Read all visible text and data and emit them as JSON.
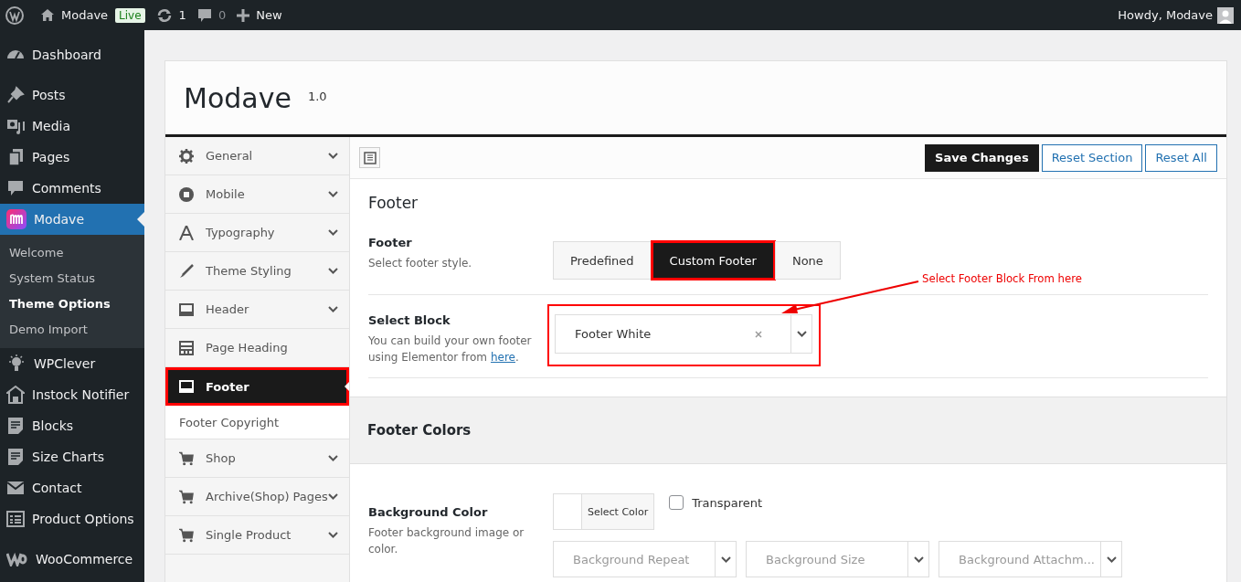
{
  "admin_bar": {
    "site_name": "Modave",
    "live_badge": "Live",
    "updates_count": "1",
    "comments_count": "0",
    "new_label": "New",
    "greeting": "Howdy, Modave"
  },
  "admin_menu": [
    [
      {
        "label": "Dashboard",
        "current": false
      }
    ],
    [
      {
        "label": "Posts",
        "current": false
      },
      {
        "label": "Media",
        "current": false
      },
      {
        "label": "Pages",
        "current": false
      },
      {
        "label": "Comments",
        "current": false
      },
      {
        "label": "Modave",
        "current": true,
        "submenu": [
          {
            "label": "Welcome",
            "current": false
          },
          {
            "label": "System Status",
            "current": false
          },
          {
            "label": "Theme Options",
            "current": true
          },
          {
            "label": "Demo Import",
            "current": false
          }
        ]
      },
      {
        "label": "WPClever",
        "current": false
      },
      {
        "label": "Instock Notifier",
        "current": false
      },
      {
        "label": "Blocks",
        "current": false
      },
      {
        "label": "Size Charts",
        "current": false
      },
      {
        "label": "Contact",
        "current": false
      },
      {
        "label": "Product Options",
        "current": false
      }
    ],
    [
      {
        "label": "WooCommerce",
        "current": false
      }
    ]
  ],
  "panel": {
    "title": "Modave",
    "version": "1.0",
    "nav": [
      {
        "label": "General",
        "expandable": true,
        "selected": false,
        "highlighted": false
      },
      {
        "label": "Mobile",
        "expandable": true,
        "selected": false,
        "highlighted": false
      },
      {
        "label": "Typography",
        "expandable": true,
        "selected": false,
        "highlighted": false
      },
      {
        "label": "Theme Styling",
        "expandable": true,
        "selected": false,
        "highlighted": false
      },
      {
        "label": "Header",
        "expandable": true,
        "selected": false,
        "highlighted": false
      },
      {
        "label": "Page Heading",
        "expandable": false,
        "selected": false,
        "highlighted": false
      },
      {
        "label": "Footer",
        "expandable": false,
        "selected": true,
        "highlighted": true,
        "children": [
          {
            "label": "Footer Copyright",
            "selected": false
          }
        ]
      },
      {
        "label": "Shop",
        "expandable": true,
        "selected": false,
        "highlighted": false
      },
      {
        "label": "Archive(Shop) Pages",
        "expandable": true,
        "selected": false,
        "highlighted": false
      },
      {
        "label": "Single Product",
        "expandable": true,
        "selected": false,
        "highlighted": false
      }
    ],
    "toolbar_buttons": [
      {
        "label": "Save Changes",
        "kind": "primary"
      },
      {
        "label": "Reset Section",
        "kind": "secondary"
      },
      {
        "label": "Reset All",
        "kind": "secondary"
      }
    ],
    "section_title": "Footer",
    "fields": [
      {
        "kind": "buttonset",
        "label": "Footer",
        "description": "Select footer style.",
        "options": [
          {
            "label": "Predefined",
            "selected": false,
            "highlighted": false
          },
          {
            "label": "Custom Footer",
            "selected": true,
            "highlighted": true
          },
          {
            "label": "None",
            "selected": false,
            "highlighted": false
          }
        ]
      },
      {
        "kind": "select",
        "label": "Select Block",
        "description": "You can build your own footer using Elementor from",
        "link": "here",
        "link_suffix": ".",
        "value": "Footer White",
        "highlighted": true
      }
    ],
    "subsection_title": "Footer Colors",
    "color_field": {
      "label": "Background Color",
      "description": "Footer background image or color.",
      "picker_label": "Select Color",
      "transparent_label": "Transparent",
      "transparent_checked": false,
      "selects": [
        {
          "placeholder": "Background Repeat"
        },
        {
          "placeholder": "Background Size"
        },
        {
          "placeholder": "Background Attachm..."
        }
      ]
    }
  },
  "annotation": {
    "text": "Select Footer Block From here"
  }
}
